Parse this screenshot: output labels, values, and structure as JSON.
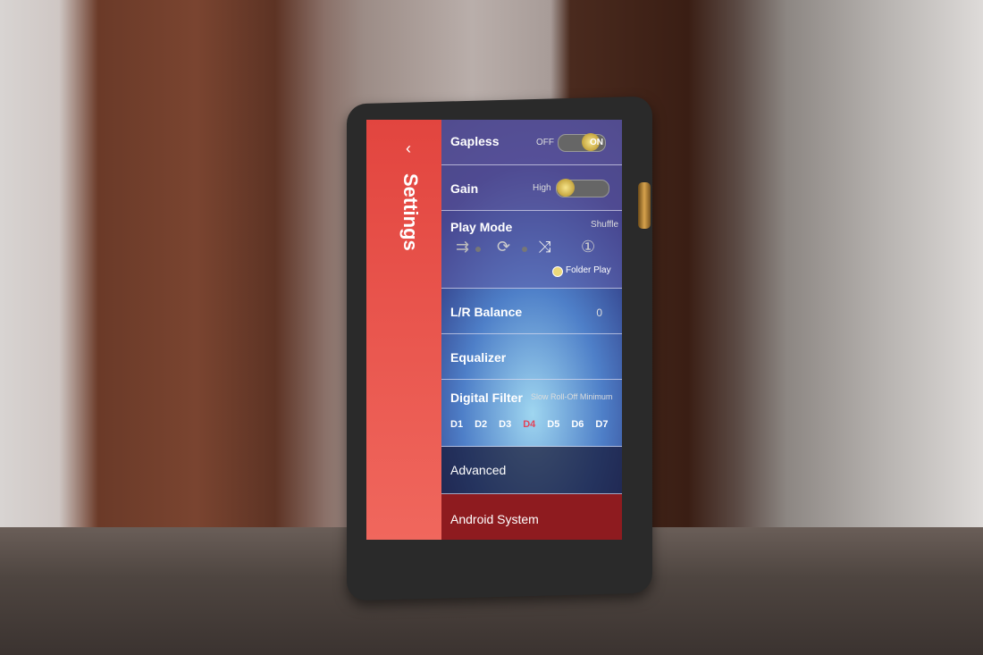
{
  "sidebar": {
    "title": "Settings",
    "back_icon": "chevron-left"
  },
  "rows": {
    "gapless": {
      "label": "Gapless",
      "off": "OFF",
      "on": "ON",
      "state": "ON"
    },
    "gain": {
      "label": "Gain",
      "value": "High"
    },
    "play_mode": {
      "label": "Play Mode",
      "current": "Shuffle",
      "icons": [
        "sequential-icon",
        "repeat-all-icon",
        "shuffle-icon",
        "repeat-one-icon"
      ],
      "folder_play": "Folder Play"
    },
    "balance": {
      "label": "L/R Balance",
      "value": "0"
    },
    "equalizer": {
      "label": "Equalizer"
    },
    "digital_filter": {
      "label": "Digital Filter",
      "current": "Slow Roll-Off Minimum",
      "options": [
        "D1",
        "D2",
        "D3",
        "D4",
        "D5",
        "D6",
        "D7"
      ],
      "selected": "D4"
    },
    "advanced": {
      "label": "Advanced"
    },
    "android": {
      "label": "Android System"
    }
  },
  "colors": {
    "accent": "#e2453f",
    "selected_filter": "#e2445a",
    "android_row": "#8e1b1f"
  }
}
